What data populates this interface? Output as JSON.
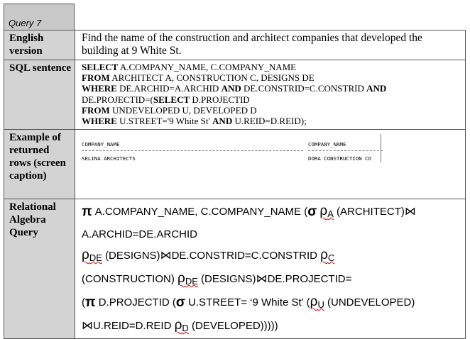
{
  "query_title": "Query 7",
  "rows": {
    "english": {
      "label": "English version",
      "text": "Find the name of the construction and architect companies that developed the building at 9 White St."
    },
    "sql": {
      "label": "SQL sentence",
      "lines": [
        {
          "kw": "SELECT",
          "rest": " A.COMPANY_NAME, C.COMPANY_NAME"
        },
        {
          "kw": "FROM",
          "rest": " ARCHITECT A, CONSTRUCTION C, DESIGNS DE"
        },
        {
          "kw": "WHERE",
          "rest": " DE.ARCHID=A.ARCHID ",
          "kw2": "AND",
          "rest2": " DE.CONSTRID=C.CONSTRID ",
          "kw3": "AND"
        },
        {
          "pre": "DE.PROJECTID=(",
          "kw": "SELECT",
          "rest": " D.PROJECTID"
        },
        {
          "kw": "FROM",
          "rest": " UNDEVELOPED U, DEVELOPED D"
        },
        {
          "kw": "WHERE",
          "rest": " U.STREET='9 White St' ",
          "kw2": "AND",
          "rest2": " U.REID=D.REID);"
        }
      ]
    },
    "example": {
      "label": "Example of returned rows (screen caption)",
      "col1_header": "COMPANY_NAME",
      "col2_header": "COMPANY_NAME",
      "col1_value": "SELINA ARCHITECTS",
      "col2_value": "DORA CONSTRUCTION CO"
    },
    "relational": {
      "label": "Relational Algebra Query",
      "pi": "π",
      "sigma": "σ",
      "rho": "ρ",
      "join": "⋈",
      "l1a": " A.COMPANY_NAME, C.COMPANY_NAME (",
      "l1b": " ",
      "sub_a": "A",
      "l1c": " (ARCHITECT)",
      "l2": "A.ARCHID=DE.ARCHID",
      "sub_de": "DE",
      "l3a": " (DESIGNS)",
      "l3b": "DE.CONSTRID=C.CONSTRID ",
      "sub_c": "C",
      "l4a": "(CONSTRUCTION) ",
      "l4b": " (DESIGNS)",
      "l4c": "DE.PROJECTID=",
      "l5a": "(",
      "l5b": " D.PROJECTID (",
      "l5c": " U.STREET= ‘9 White St’ (",
      "sub_u": "U",
      "l5d": " (UNDEVELOPED)",
      "l6a": "U.REID=D.REID ",
      "sub_d": "D",
      "l6b": " (DEVELOPED)))))"
    }
  }
}
